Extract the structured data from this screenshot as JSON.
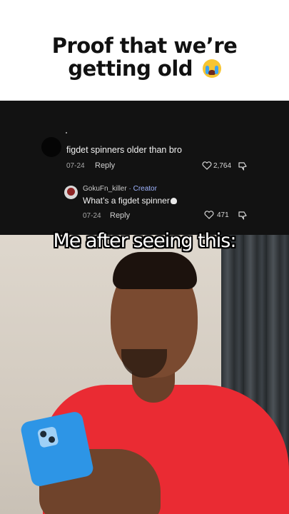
{
  "title": {
    "line1": "Proof that we’re",
    "line2": "getting old",
    "emoji": "loudly-crying-face-emoji"
  },
  "comments": [
    {
      "username": ".",
      "text": "figdet spinners older than bro",
      "date": "07-24",
      "reply_label": "Reply",
      "likes": "2,764"
    },
    {
      "username": "GokuFn_killer",
      "role": "· Creator",
      "text": "What’s a figdet spinner",
      "text_emoji": "skull-emoji",
      "date": "07-24",
      "reply_label": "Reply",
      "likes": "471"
    }
  ],
  "caption": "Me after seeing this:",
  "colors": {
    "comment_bg": "#121212",
    "creator_label": "#9fb4ff",
    "shirt": "#ea2b33",
    "phone_case": "#2d95e6"
  }
}
